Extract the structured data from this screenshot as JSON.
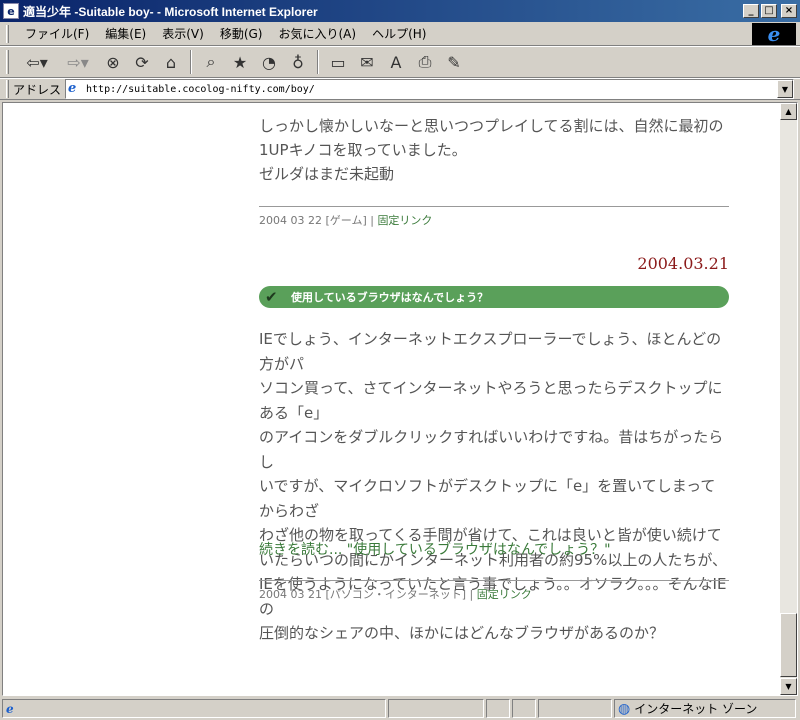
{
  "window": {
    "title": "適当少年 -Suitable boy- - Microsoft Internet Explorer",
    "minimize": "_",
    "maximize": "□",
    "close": "×"
  },
  "menu": {
    "items": [
      "ファイル(F)",
      "編集(E)",
      "表示(V)",
      "移動(G)",
      "お気に入り(A)",
      "ヘルプ(H)"
    ]
  },
  "toolbar": {
    "icons": [
      "back-icon",
      "forward-icon",
      "stop-icon",
      "refresh-icon",
      "home-icon",
      "search-icon",
      "favorites-icon",
      "history-icon",
      "channels-icon",
      "fullscreen-icon",
      "mail-icon",
      "font-icon",
      "print-icon",
      "edit-icon"
    ]
  },
  "address": {
    "label": "アドレス",
    "url": "http://suitable.cocolog-nifty.com/boy/"
  },
  "page": {
    "prev_entry": {
      "lines": [
        "しっかし懐かしいなーと思いつつプレイしてる割には、自然に最初の",
        "1UPキノコを取っていました。",
        "ゼルダはまだ未起動"
      ],
      "footer": {
        "meta": "2004 03 22 [ゲーム] | ",
        "permalink": "固定リンク"
      }
    },
    "date_header": "2004.03.21",
    "entry": {
      "title": "使用しているブラウザはなんでしょう？",
      "body": [
        "IEでしょう、インターネットエクスプローラーでしょう、ほとんどの方がパ",
        "ソコン買って、さてインターネットやろうと思ったらデスクトップにある「e」",
        "のアイコンをダブルクリックすればいいわけですね。昔はちがったらし",
        "いですが、マイクロソフトがデスクトップに「e」を置いてしまってからわざ",
        "わざ他の物を取ってくる手間が省けて、これは良いと皆が使い続けて",
        "いたらいつの間にかインターネット利用者の約95%以上の人たちが、",
        "IEを使うようになっていたと言う事でしょう。。オソラク。。。そんなIEの",
        "圧倒的なシェアの中、ほかにはどんなブラウザがあるのか？"
      ],
      "continue": "続きを読む... \"使用しているブラウザはなんでしょう？\"",
      "footer": {
        "meta": "2004 03 21 [パソコン・インターネット] | ",
        "permalink": "固定リンク"
      }
    }
  },
  "status": {
    "zone": "インターネット ゾーン"
  }
}
